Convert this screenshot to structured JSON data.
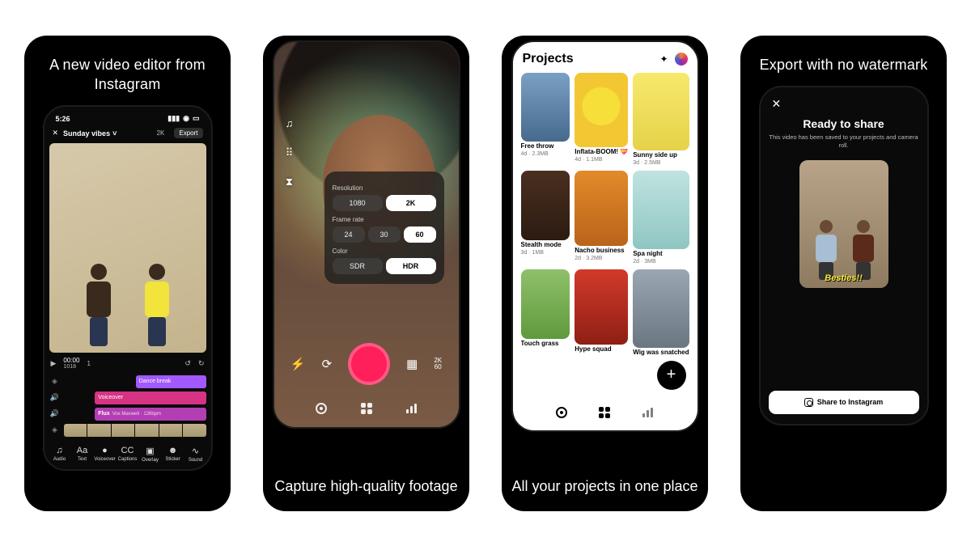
{
  "panel1": {
    "headline": "A new video editor from Instagram",
    "status_time": "5:26",
    "close_icon": "x",
    "project_title": "Sunday vibes",
    "quality_badge": "2K",
    "export_label": "Export",
    "timecode": "00:00",
    "scrub_pos": "1018",
    "clips": {
      "dance": "Dance break",
      "voiceover": "Voiceover",
      "flux": "Flux",
      "flux_detail": "Vox Maxwell · 126bpm"
    },
    "tools": [
      {
        "icon": "♫",
        "label": "Audio"
      },
      {
        "icon": "Aa",
        "label": "Text"
      },
      {
        "icon": "●",
        "label": "Voiceover"
      },
      {
        "icon": "CC",
        "label": "Captions"
      },
      {
        "icon": "▣",
        "label": "Overlay"
      },
      {
        "icon": "☻",
        "label": "Sticker"
      },
      {
        "icon": "∿",
        "label": "Sound"
      }
    ]
  },
  "panel2": {
    "caption": "Capture high-quality footage",
    "settings": {
      "resolution_label": "Resolution",
      "resolution_options": [
        "1080",
        "2K"
      ],
      "resolution_selected": "2K",
      "framerate_label": "Frame rate",
      "framerate_options": [
        "24",
        "30",
        "60"
      ],
      "framerate_selected": "60",
      "color_label": "Color",
      "color_options": [
        "SDR",
        "HDR"
      ],
      "color_selected": "HDR"
    },
    "right_badge": "2K\n60"
  },
  "panel3": {
    "caption": "All your projects in one place",
    "header": "Projects",
    "projects": [
      {
        "name": "Free throw",
        "meta": "4d · 2.3MB",
        "bg": "bg1"
      },
      {
        "name": "Inflata-BOOM! 💝",
        "meta": "4d · 1.1MB",
        "bg": "bg2"
      },
      {
        "name": "Sunny side up",
        "meta": "3d · 2.5MB",
        "bg": "bg3"
      },
      {
        "name": "Stealth mode",
        "meta": "3d · 1MB",
        "bg": "bg4"
      },
      {
        "name": "Nacho business",
        "meta": "2d · 3.2MB",
        "bg": "bg5"
      },
      {
        "name": "Spa night",
        "meta": "2d · 3MB",
        "bg": "bg6"
      },
      {
        "name": "Touch grass",
        "meta": "",
        "bg": "bg7"
      },
      {
        "name": "Hype squad",
        "meta": "",
        "bg": "bg8"
      },
      {
        "name": "Wig was snatched",
        "meta": "",
        "bg": "bg9"
      }
    ]
  },
  "panel4": {
    "headline": "Export with no watermark",
    "ready_title": "Ready to share",
    "ready_sub": "This video has been saved to your projects and camera roll.",
    "overlay_text": "Besties!!",
    "share_label": "Share to Instagram"
  }
}
